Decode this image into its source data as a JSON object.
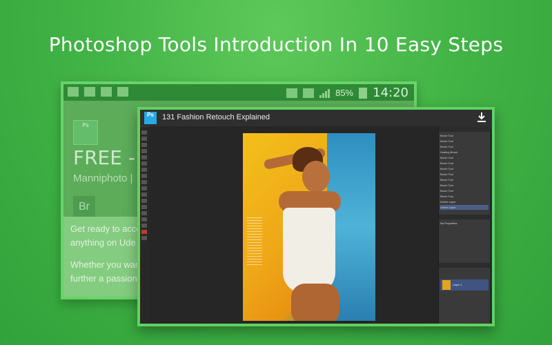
{
  "headline": "Photoshop Tools Introduction In 10 Easy Steps",
  "back_screen": {
    "status": {
      "battery": "85%",
      "time": "14:20"
    },
    "app_icon_text": "Ps",
    "title": "FREE - P",
    "subtitle": "Manniphoto | ",
    "badge": "Br",
    "paragraph_1": "Get ready to acce",
    "paragraph_1b": "anything on Ude",
    "paragraph_2": "Whether you wan",
    "paragraph_2b": "further a passion,"
  },
  "front_screen": {
    "app_icon_text": "Ps",
    "video_title": "131  Fashion Retouch Explained",
    "history_items": [
      "Brush Tool",
      "Brush Tool",
      "Brush Tool",
      "Healing Brush",
      "Brush Tool",
      "Brush Tool",
      "Brush Tool",
      "Brush Tool",
      "Brush Tool",
      "Brush Tool",
      "Brush Tool",
      "Brush Tool",
      "Delete Layer",
      "Delete Layer"
    ],
    "properties_label": "No Properties",
    "layer_name": "Layer 1"
  },
  "colors": {
    "background": "#43b446",
    "frame_border": "#62d161",
    "ps_blue": "#27a9e1"
  }
}
